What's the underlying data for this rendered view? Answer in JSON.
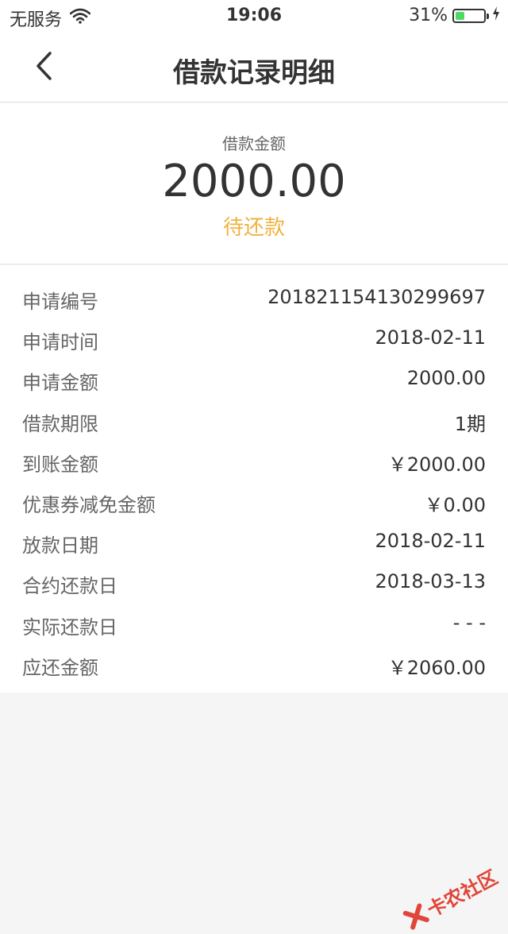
{
  "status_bar": {
    "carrier": "无服务",
    "time": "19:06",
    "battery": "31%",
    "battery_level": 0.31,
    "icons": [
      "wifi-icon",
      "battery-icon",
      "charging-icon"
    ]
  },
  "nav": {
    "title": "借款记录明细",
    "back_icon": "chevron-left-icon"
  },
  "summary": {
    "label": "借款金额",
    "amount": "2000.00",
    "status": "待还款",
    "status_color": "#f0b23e"
  },
  "details": [
    {
      "label": "申请编号",
      "value": "201821154130299697"
    },
    {
      "label": "申请时间",
      "value": "2018-02-11"
    },
    {
      "label": "申请金额",
      "value": "2000.00"
    },
    {
      "label": "借款期限",
      "value": "1期"
    },
    {
      "label": "到账金额",
      "value": "￥2000.00"
    },
    {
      "label": "优惠券减免金额",
      "value": "￥0.00"
    },
    {
      "label": "放款日期",
      "value": "2018-02-11"
    },
    {
      "label": "合约还款日",
      "value": "2018-03-13"
    },
    {
      "label": "实际还款日",
      "value": "- - -"
    },
    {
      "label": "应还金额",
      "value": "￥2060.00"
    }
  ],
  "watermark": {
    "text": "卡农社区",
    "color": "#e0463a"
  }
}
